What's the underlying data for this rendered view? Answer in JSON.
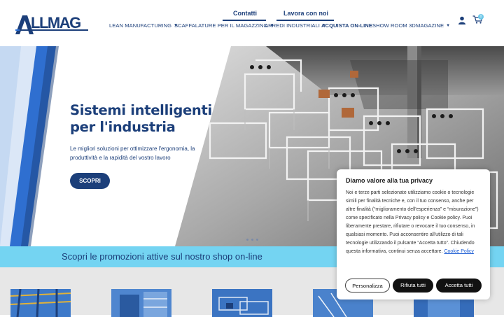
{
  "header": {
    "logo_text": "ALLMAG",
    "top_links": [
      "Contatti",
      "Lavora con noi"
    ],
    "nav": [
      {
        "label": "LEAN MANUFACTURING",
        "dropdown": true,
        "bold": false
      },
      {
        "label": "SCAFFALATURE PER IL MAGAZZINO",
        "dropdown": true,
        "bold": false
      },
      {
        "label": "ARREDI INDUSTRIALI",
        "dropdown": true,
        "bold": false
      },
      {
        "label": "ACQUISTA ON-LINE",
        "dropdown": false,
        "bold": true
      },
      {
        "label": "SHOW ROOM 3D",
        "dropdown": false,
        "bold": false
      },
      {
        "label": "MAGAZINE",
        "dropdown": true,
        "bold": false
      }
    ],
    "icons": [
      "user-icon",
      "cart-icon"
    ],
    "cart_count": "0"
  },
  "hero": {
    "title": "Sistemi intelligenti per l'industria",
    "subtitle": "Le migliori soluzioni per ottimizzare l'ergonomia, la produttività e la rapidità del vostro lavoro",
    "cta": "SCOPRI",
    "slides": 3
  },
  "promo": {
    "text": "Scopri le promozioni attive sul nostro shop on-line"
  },
  "cookie": {
    "title": "Diamo valore alla tua privacy",
    "text": "Noi e terze parti selezionate utilizziamo cookie o tecnologie simili per finalità tecniche e, con il tuo consenso, anche per altre finalità (“miglioramento dell'esperienza” e “misurazione”) come specificato nella Privacy policy e Cookie policy. Puoi liberamente prestare, rifiutare o revocare il tuo consenso, in qualsiasi momento. Puoi acconsentire all'utilizzo di tali tecnologie utilizzando il pulsante “Accetta tutto”. Chiudendo questa informativa, continui senza accettare.",
    "link": "Cookie Policy",
    "buttons": [
      "Personalizza",
      "Rifiuta tutti",
      "Accetta tutti"
    ]
  },
  "colors": {
    "brand": "#1c3f7a",
    "promo_bg": "#74d4f2",
    "products_bg": "#e7e7e7"
  }
}
